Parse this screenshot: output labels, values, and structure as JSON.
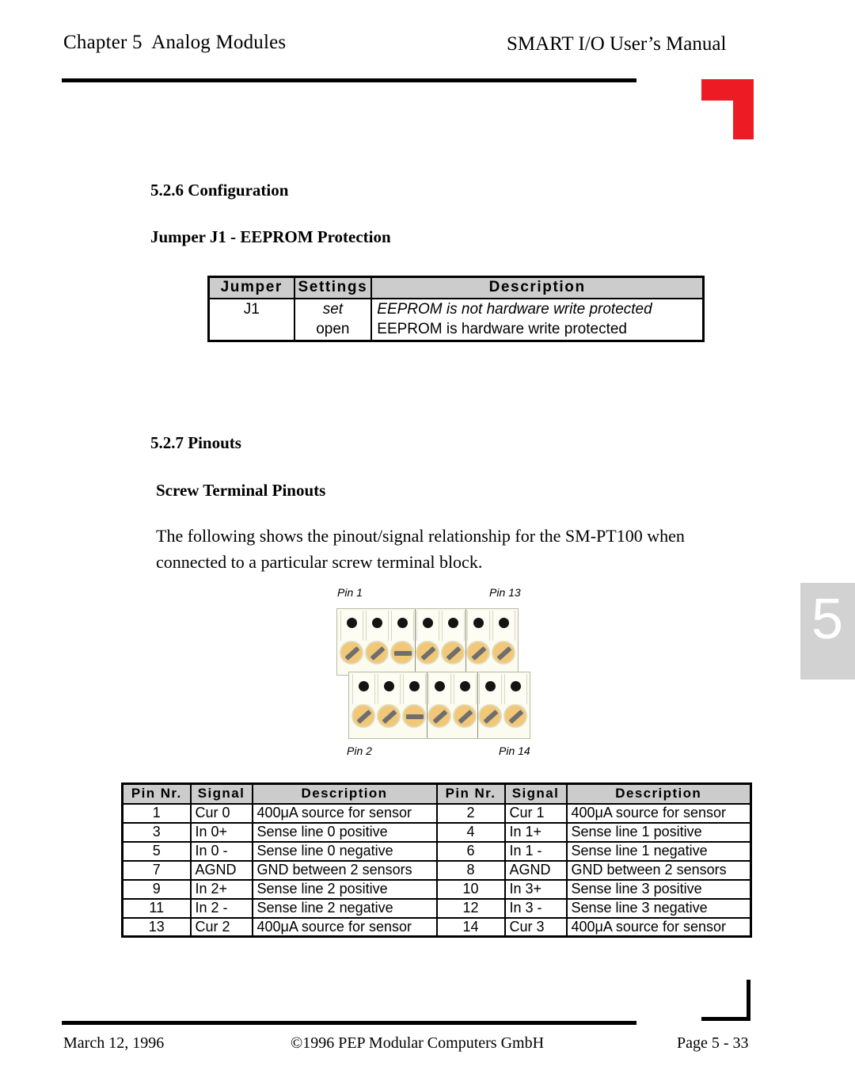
{
  "header": {
    "chapter": "Chapter 5  Analog Modules",
    "manual_title": "SMART I/O User’s Manual",
    "logo_name": "pep-corner-logo",
    "accent_color": "#ED1C24"
  },
  "chapter_tab": {
    "number": "5",
    "background": "#d2d2d2"
  },
  "sections": {
    "config_heading": "5.2.6 Configuration",
    "jumper_heading": "Jumper J1 - EEPROM Protection",
    "pinouts_heading": "5.2.7 Pinouts",
    "screw_heading": "Screw Terminal Pinouts",
    "intro_paragraph": "The following shows the pinout/signal relationship for the SM-PT100 when\nconnected to a particular screw terminal block."
  },
  "jumper_table": {
    "headers": [
      "Jumper",
      "Settings",
      "Description"
    ],
    "rows": [
      {
        "jumper": "J1",
        "setting": "set",
        "description": "EEPROM is not hardware write protected",
        "italic": true
      },
      {
        "jumper": "",
        "setting": "open",
        "description": "EEPROM is hardware write protected",
        "italic": false
      }
    ]
  },
  "terminal_diagram": {
    "label_top_left": "Pin 1",
    "label_top_right": "Pin 13",
    "label_bottom_left": "Pin 2",
    "label_bottom_right": "Pin 14",
    "screw_color": "#f0c878",
    "slot_color": "#6e6e6e",
    "block_color": "#fbfbef",
    "top_row_slots": [
      "diag",
      "diag",
      "flat",
      "diag",
      "diag",
      "diag",
      "diag"
    ],
    "bottom_row_slots": [
      "diag",
      "diag",
      "flat",
      "diag",
      "diag",
      "diag",
      "diag"
    ]
  },
  "pinout_table": {
    "headers": [
      "Pin  Nr.",
      "Signal",
      "Description",
      "Pin  Nr.",
      "Signal",
      "Description"
    ],
    "rows": [
      {
        "pin_l": "1",
        "sig_l": "Cur 0",
        "desc_l": "400μA source for sensor",
        "pin_r": "2",
        "sig_r": "Cur 1",
        "desc_r": "400μA source for sensor"
      },
      {
        "pin_l": "3",
        "sig_l": "In 0+",
        "desc_l": "Sense line 0 positive",
        "pin_r": "4",
        "sig_r": "In 1+",
        "desc_r": "Sense line 1 positive"
      },
      {
        "pin_l": "5",
        "sig_l": "In 0 -",
        "desc_l": "Sense line 0 negative",
        "pin_r": "6",
        "sig_r": "In 1 -",
        "desc_r": "Sense line 1 negative"
      },
      {
        "pin_l": "7",
        "sig_l": "AGND",
        "desc_l": "GND between 2 sensors",
        "pin_r": "8",
        "sig_r": "AGND",
        "desc_r": "GND between 2 sensors"
      },
      {
        "pin_l": "9",
        "sig_l": "In 2+",
        "desc_l": "Sense line 2 positive",
        "pin_r": "10",
        "sig_r": "In 3+",
        "desc_r": "Sense line 3 positive"
      },
      {
        "pin_l": "11",
        "sig_l": "In 2 -",
        "desc_l": "Sense line 2 negative",
        "pin_r": "12",
        "sig_r": "In 3 -",
        "desc_r": "Sense line 3 negative"
      },
      {
        "pin_l": "13",
        "sig_l": "Cur 2",
        "desc_l": "400μA source for sensor",
        "pin_r": "14",
        "sig_r": "Cur 3",
        "desc_r": "400μA source for sensor"
      }
    ]
  },
  "footer": {
    "date": "March 12, 1996",
    "copyright": "©1996 PEP Modular Computers GmbH",
    "page": "Page 5 - 33"
  }
}
